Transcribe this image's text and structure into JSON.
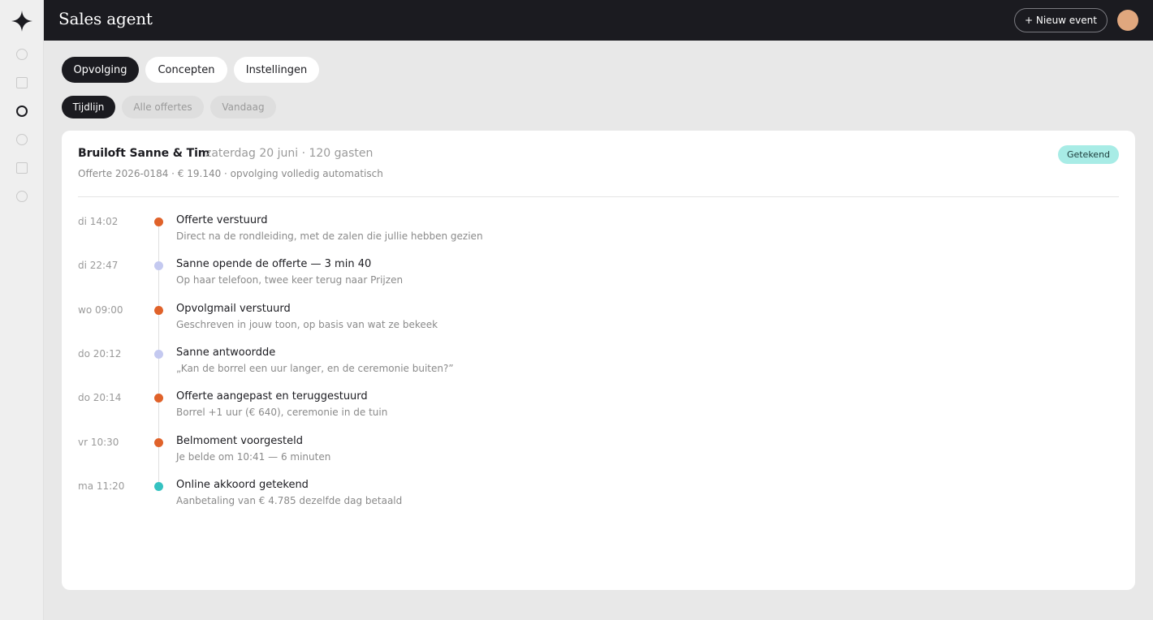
{
  "app": {
    "title": "Sales agent",
    "new_event_label": "+ Nieuw event"
  },
  "sidebar": {
    "items": [
      {
        "icon": "circle"
      },
      {
        "icon": "square"
      },
      {
        "icon": "circle",
        "active": true
      },
      {
        "icon": "circle"
      },
      {
        "icon": "square"
      },
      {
        "icon": "circle"
      }
    ]
  },
  "tabs": [
    {
      "label": "Opvolging",
      "active": true
    },
    {
      "label": "Concepten"
    },
    {
      "label": "Instellingen"
    }
  ],
  "subtabs": [
    {
      "label": "Tijdlijn",
      "active": true
    },
    {
      "label": "Alle offertes"
    },
    {
      "label": "Vandaag"
    }
  ],
  "card": {
    "title": "Bruiloft Sanne & Tim",
    "meta": "zaterdag 20 juni · 120 gasten",
    "subtitle": "Offerte 2026-0184 · € 19.140 · opvolging volledig automatisch",
    "badge": "Getekend"
  },
  "colors": {
    "orange": "#e0622a",
    "lavender": "#c4c9f0",
    "teal": "#35c2c1",
    "dark": "#1b1b20",
    "badge_bg": "#a8ece6"
  },
  "timeline": [
    {
      "time": "di 14:02",
      "title": "Offerte verstuurd",
      "desc": "Direct na de rondleiding, met de zalen die jullie hebben gezien",
      "dot": "orange"
    },
    {
      "time": "di 22:47",
      "title": "Sanne opende de offerte — 3 min 40",
      "desc": "Op haar telefoon, twee keer terug naar Prijzen",
      "dot": "lavender"
    },
    {
      "time": "wo 09:00",
      "title": "Opvolgmail verstuurd",
      "desc": "Geschreven in jouw toon, op basis van wat ze bekeek",
      "dot": "orange"
    },
    {
      "time": "do 20:12",
      "title": "Sanne antwoordde",
      "desc": "„Kan de borrel een uur langer, en de ceremonie buiten?”",
      "dot": "lavender"
    },
    {
      "time": "do 20:14",
      "title": "Offerte aangepast en teruggestuurd",
      "desc": "Borrel +1 uur (€ 640), ceremonie in de tuin",
      "dot": "orange"
    },
    {
      "time": "vr 10:30",
      "title": "Belmoment voorgesteld",
      "desc": "Je belde om 10:41 — 6 minuten",
      "dot": "orange"
    },
    {
      "time": "ma 11:20",
      "title": "Online akkoord getekend",
      "desc": "Aanbetaling van € 4.785 dezelfde dag betaald",
      "dot": "teal"
    }
  ]
}
